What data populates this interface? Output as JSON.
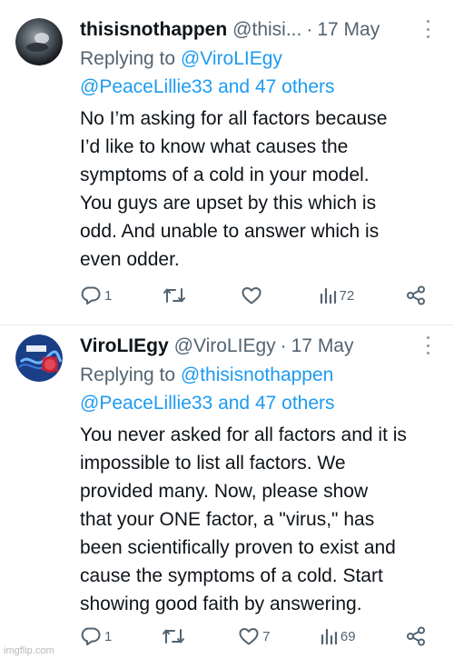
{
  "tweets": [
    {
      "name": "thisisnothappen",
      "handle": "@thisi...",
      "separator": "·",
      "date": "17 May",
      "replying_prefix": "Replying to",
      "replying_to_1": "@ViroLIEgy",
      "replying_to_2": "@PeaceLillie33 and 47 others",
      "body": "No I’m asking for all factors because\nI’d like to know what causes the\nsymptoms of a cold in your model.\nYou guys are upset by this which is\nodd. And unable to answer which is\neven odder.",
      "reply_count": "1",
      "retweet_count": "",
      "like_count": "",
      "view_count": "72"
    },
    {
      "name": "ViroLIEgy",
      "handle": "@ViroLIEgy",
      "separator": "·",
      "date": "17 May",
      "replying_prefix": "Replying to",
      "replying_to_1": "@thisisnothappen",
      "replying_to_2": "@PeaceLillie33 and 47 others",
      "body": "You never asked for all factors and it is\nimpossible to list all factors. We\nprovided many. Now, please show\nthat your ONE factor, a \"virus,\" has\nbeen scientifically proven to exist and\ncause the symptoms of a cold. Start\nshowing good faith by answering.",
      "reply_count": "1",
      "retweet_count": "",
      "like_count": "7",
      "view_count": "69"
    }
  ],
  "watermark": "imgflip.com",
  "colors": {
    "link": "#1d9bf0",
    "secondary_text": "#536471",
    "icon": "#536471"
  },
  "icons": [
    "reply-icon",
    "retweet-icon",
    "like-icon",
    "views-icon",
    "share-icon",
    "more-icon"
  ]
}
